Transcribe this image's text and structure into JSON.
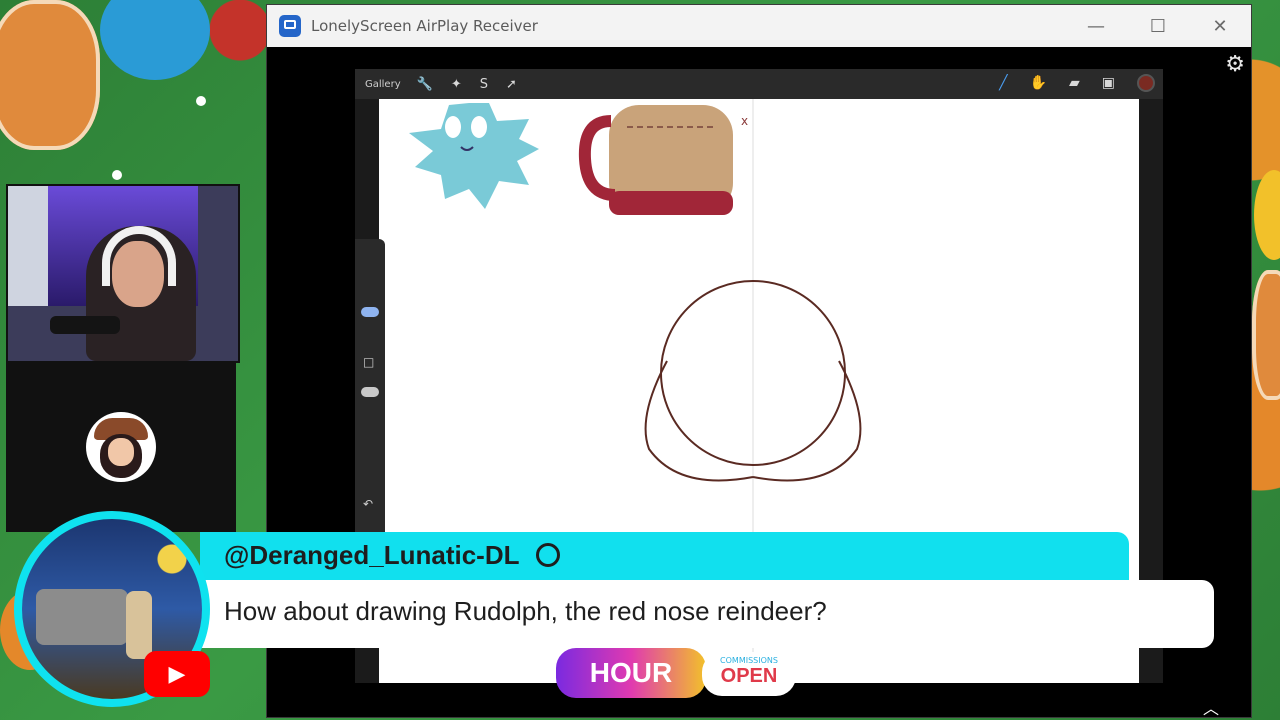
{
  "window": {
    "title": "LonelyScreen AirPlay Receiver",
    "buttons": {
      "minimize": "—",
      "maximize": "☐",
      "close": "✕"
    },
    "settings_icon": "gear-icon"
  },
  "procreate": {
    "gallery_label": "Gallery",
    "left_tools": [
      "wrench-icon",
      "magic-wand-icon",
      "selection-icon",
      "transform-icon"
    ],
    "right_tools": [
      "brush-icon",
      "smudge-icon",
      "eraser-icon",
      "layers-icon"
    ],
    "current_color": "#7a2a22"
  },
  "chat": {
    "username": "@Deranged_Lunatic-DL",
    "message": "How about drawing Rudolph, the red nose reindeer?",
    "platform": "youtube-icon"
  },
  "banner": {
    "hour_text": "HOUR",
    "commissions_text": "COMMISSIONS",
    "open_text": "OPEN"
  },
  "colors": {
    "chat_accent": "#11e0ee",
    "window_titlebar": "#f3f3f3"
  }
}
